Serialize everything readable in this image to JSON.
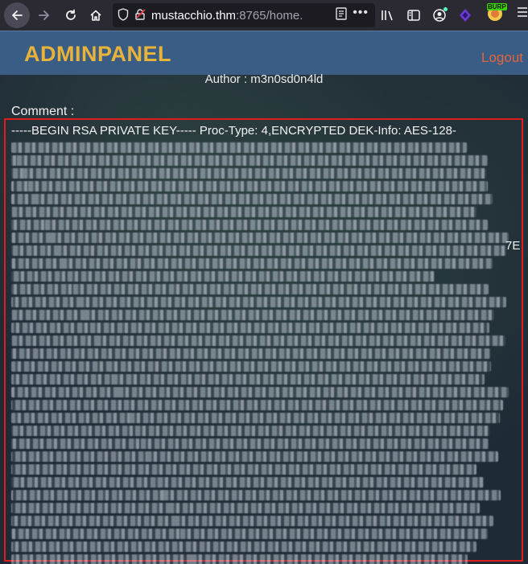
{
  "browser": {
    "url_host": "mustacchio.thm",
    "url_rest": ":8765/home.",
    "icons": [
      "back-arrow-icon",
      "forward-arrow-icon",
      "reload-icon",
      "home-icon",
      "shield-icon",
      "insecure-lock-icon",
      "reader-view-icon",
      "more-icon",
      "library-icon",
      "sidebar-icon",
      "account-icon",
      "extension-icon",
      "burp-icon",
      "menu-icon"
    ],
    "burp_badge": "BURP"
  },
  "navbar": {
    "brand": "ADMINPANEL",
    "logout": "Logout",
    "brand_color": "#e8b33a",
    "logout_color": "#e3653f",
    "bar_color": "#3a5d86"
  },
  "post": {
    "author": "Author : m3n0sd0n4ld",
    "comment_label": "Comment :",
    "key_first_line": "-----BEGIN RSA PRIVATE KEY----- Proc-Type: 4,ENCRYPTED DEK-Info: AES-128-",
    "key_tail": "7E",
    "highlight_color": "#e01d1d"
  }
}
